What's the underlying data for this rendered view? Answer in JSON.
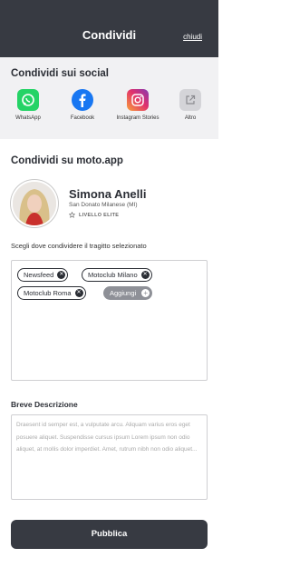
{
  "header": {
    "title": "Condividi",
    "close_label": "chiudi"
  },
  "social": {
    "title": "Condividi sui social",
    "items": [
      {
        "label": "WhatsApp",
        "icon": "whatsapp-icon",
        "color": "#25d366"
      },
      {
        "label": "Facebook",
        "icon": "facebook-icon",
        "color": "#1877f2"
      },
      {
        "label": "Instagram Stories",
        "icon": "instagram-icon",
        "color": "#e1306c"
      },
      {
        "label": "Altro",
        "icon": "external-link-icon",
        "color": "#cfcfd2"
      }
    ]
  },
  "main": {
    "title": "Condividi su moto.app",
    "user": {
      "name": "Simona Anelli",
      "location": "San Donato Milanese (MI)",
      "level": "LIVELLO ELITE"
    },
    "choose_label": "Scegli dove condividere il tragitto selezionato",
    "tags": [
      "Newsfeed",
      "Motoclub Milano",
      "Motoclub Roma"
    ],
    "add_label": "Aggiungi",
    "description": {
      "label": "Breve Descrizione",
      "placeholder": "Draesent id semper est, a vulputate arcu. Aliquam varius eros eget posuere aliquet. Suspendisse cursus ipsum Lorem ipsum non odio aliquet, at mollis dolor imperdiet. Amet, rutrum nibh non odio aliquet..."
    },
    "publish_label": "Pubblica"
  },
  "colors": {
    "dark": "#373a42",
    "panel": "#f1f1f3",
    "tag_add": "#8e9097"
  }
}
